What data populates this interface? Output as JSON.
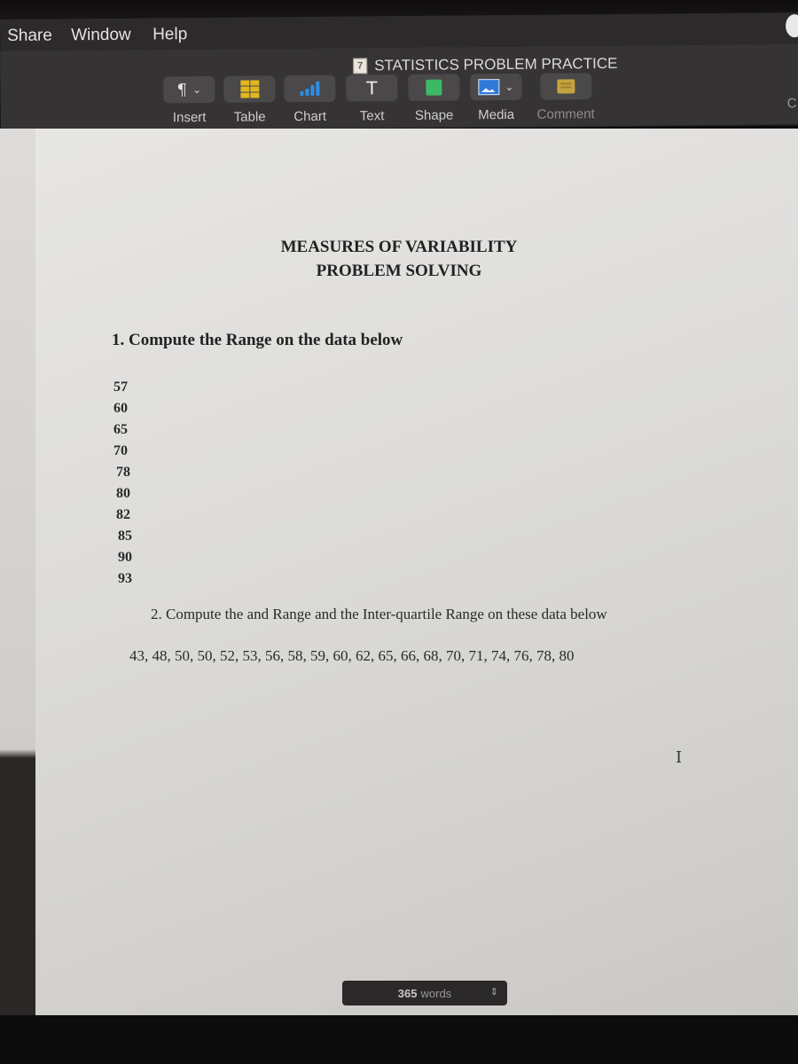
{
  "menubar": {
    "items": [
      "Share",
      "Window",
      "Help"
    ]
  },
  "window": {
    "document_title": "STATISTICS PROBLEM PRACTICE",
    "doc_icon_label": "7"
  },
  "toolbar": {
    "tools": [
      {
        "label": "Insert",
        "icon": "pilcrow-icon"
      },
      {
        "label": "Table",
        "icon": "table-icon"
      },
      {
        "label": "Chart",
        "icon": "chart-icon"
      },
      {
        "label": "Text",
        "icon": "text-icon"
      },
      {
        "label": "Shape",
        "icon": "shape-icon"
      },
      {
        "label": "Media",
        "icon": "media-icon"
      },
      {
        "label": "Comment",
        "icon": "comment-icon"
      }
    ],
    "clipped_right_label": "C",
    "colors": {
      "table": "#e2b620",
      "chart": "#2e8fe8",
      "shape": "#3db865",
      "media": "#2f78d8",
      "comment": "#c4a23e"
    }
  },
  "document": {
    "title_line1": "MEASURES OF VARIABILITY",
    "title_line2": "PROBLEM SOLVING",
    "question1": "1. Compute the Range on the data below",
    "question1_values": [
      "57",
      "60",
      "65",
      "70",
      "78",
      "80",
      "82",
      "85",
      "90",
      "93"
    ],
    "question2": "2.  Compute the and Range and the Inter-quartile Range on these data below",
    "question2_data": "43, 48, 50, 50, 52, 53, 56, 58, 59, 60, 62, 65, 66, 68, 70, 71, 74, 76, 78, 80"
  },
  "status": {
    "word_count_number": "365",
    "word_count_unit": "words",
    "stepper_glyph": "⌃⌄"
  },
  "cursor_glyph": "I"
}
